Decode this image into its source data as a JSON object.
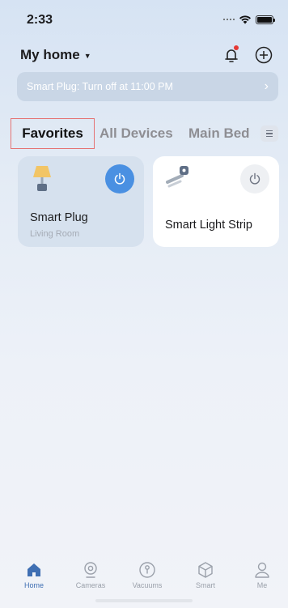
{
  "status_bar": {
    "time": "2:33"
  },
  "header": {
    "title": "My home"
  },
  "banner": {
    "text": "Smart Plug: Turn off at 11:00 PM"
  },
  "tabs": [
    {
      "label": "Favorites",
      "active": true
    },
    {
      "label": "All Devices",
      "active": false
    },
    {
      "label": "Main Bed",
      "active": false
    }
  ],
  "devices": [
    {
      "name": "Smart Plug",
      "room": "Living Room",
      "power": "on"
    },
    {
      "name": "Smart Light Strip",
      "room": "",
      "power": "off"
    }
  ],
  "bottom_nav": [
    {
      "label": "Home",
      "icon": "home-icon",
      "active": true
    },
    {
      "label": "Cameras",
      "icon": "camera-icon",
      "active": false
    },
    {
      "label": "Vacuums",
      "icon": "vacuum-icon",
      "active": false
    },
    {
      "label": "Smart",
      "icon": "cube-icon",
      "active": false
    },
    {
      "label": "Me",
      "icon": "person-icon",
      "active": false
    }
  ],
  "colors": {
    "accent": "#4a90e2",
    "active_nav": "#3f6fb3",
    "notification_dot": "#e53935"
  }
}
